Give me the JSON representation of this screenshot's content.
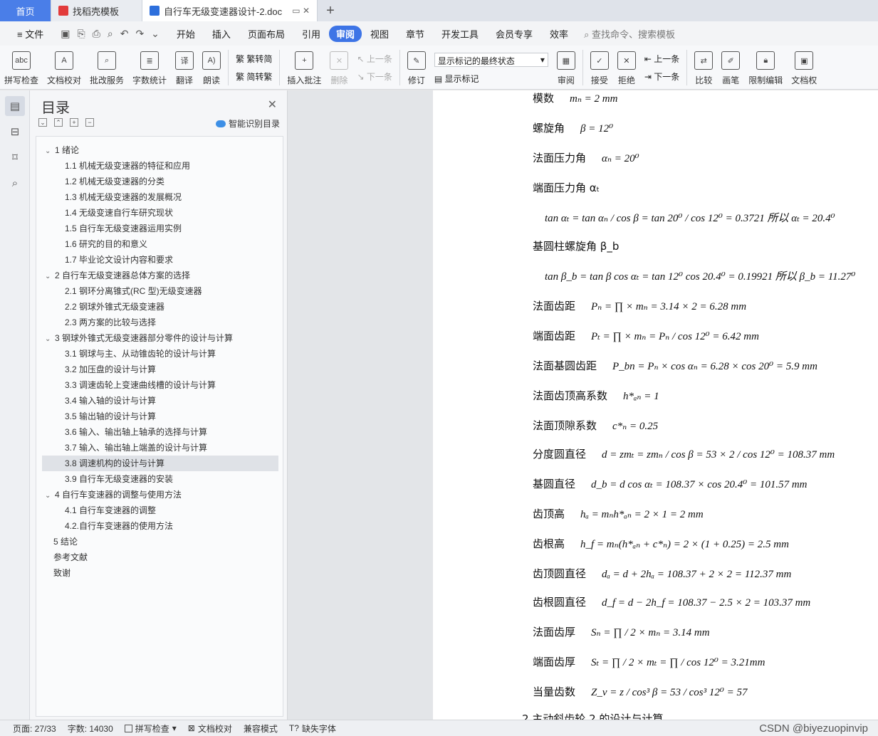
{
  "tabs": [
    {
      "label": "首页"
    },
    {
      "label": "找稻壳模板"
    },
    {
      "label": "自行车无级变速器设计-2.doc"
    }
  ],
  "menu": {
    "file": "文件",
    "items": [
      "开始",
      "插入",
      "页面布局",
      "引用",
      "审阅",
      "视图",
      "章节",
      "开发工具",
      "会员专享",
      "效率"
    ],
    "active": "审阅",
    "search": "查找命令、搜索模板"
  },
  "ribbon": {
    "spell": "拼写检查",
    "doccheck": "文档校对",
    "annotate_service": "批改服务",
    "wordcount": "字数统计",
    "translate": "翻译",
    "read": "朗读",
    "trad": "繁转简",
    "simp": "简转繁",
    "insert_comment": "插入批注",
    "delete": "删除",
    "prev": "上一条",
    "next": "下一条",
    "revise": "修订",
    "show_state": "显示标记的最终状态",
    "show_marks": "显示标记",
    "review": "审阅",
    "accept": "接受",
    "reject": "拒绝",
    "prev2": "上一条",
    "next2": "下一条",
    "compare": "比较",
    "pen": "画笔",
    "restrict": "限制编辑",
    "docpower": "文档权"
  },
  "toc": {
    "title": "目录",
    "smart": "智能识别目录",
    "items": [
      {
        "label": "1 绪论",
        "level": 1
      },
      {
        "label": "1.1    机械无级变速器的特征和应用",
        "level": 2
      },
      {
        "label": "1.2   机械无级变速器的分类",
        "level": 2
      },
      {
        "label": "1.3   机械无级变速器的发展概况",
        "level": 2
      },
      {
        "label": "1.4   无级变速自行车研究现状",
        "level": 2
      },
      {
        "label": "1.5  自行车无级变速器运用实例",
        "level": 2
      },
      {
        "label": "1.6  研究的目的和意义",
        "level": 2
      },
      {
        "label": "1.7  毕业论文设计内容和要求",
        "level": 2
      },
      {
        "label": "2  自行车无级变速器总体方案的选择",
        "level": 1
      },
      {
        "label": "2.1    钢环分离锥式(RC 型)无级变速器",
        "level": 2
      },
      {
        "label": "2.2    钢球外锥式无级变速器",
        "level": 2
      },
      {
        "label": "2.3    两方案的比较与选择",
        "level": 2
      },
      {
        "label": "3  钢球外锥式无级变速器部分零件的设计与计算",
        "level": 1
      },
      {
        "label": "3.1    钢球与主、从动锥齿轮的设计与计算",
        "level": 2
      },
      {
        "label": "3.2    加压盘的设计与计算",
        "level": 2
      },
      {
        "label": "3.3    调速齿轮上变速曲线槽的设计与计算",
        "level": 2
      },
      {
        "label": "3.4    输入轴的设计与计算",
        "level": 2
      },
      {
        "label": "3.5    输出轴的设计与计算",
        "level": 2
      },
      {
        "label": "3.6    输入、输出轴上轴承的选择与计算",
        "level": 2
      },
      {
        "label": "3.7    输入、输出轴上端盖的设计与计算",
        "level": 2
      },
      {
        "label": "3.8    调速机构的设计与计算",
        "level": 2,
        "selected": true
      },
      {
        "label": "3.9    自行车无级变速器的安装",
        "level": 2
      },
      {
        "label": "4  自行车变速器的调整与使用方法",
        "level": 1
      },
      {
        "label": "4.1  自行车变速器的调整",
        "level": 2
      },
      {
        "label": "4.2.自行车变速器的使用方法",
        "level": 2
      },
      {
        "label": "5  结论",
        "level": 0
      },
      {
        "label": "参考文献",
        "level": 0
      },
      {
        "label": "致谢",
        "level": 0
      }
    ]
  },
  "doc": {
    "lines": [
      {
        "label": "模数",
        "formula": "mₙ = 2   mm"
      },
      {
        "label": "螺旋角",
        "formula": "β = 12⁰"
      },
      {
        "label": "法面压力角",
        "formula": "αₙ = 20⁰"
      },
      {
        "label": "端面压力角 αₜ",
        "formula": ""
      },
      {
        "label": "",
        "formula": "tan αₜ = tan αₙ / cos β = tan 20⁰ / cos 12⁰ = 0.3721    所以     αₜ = 20.4⁰"
      },
      {
        "label": "基圆柱螺旋角 β_b",
        "formula": ""
      },
      {
        "label": "",
        "formula": "tan β_b = tan β cos αₜ = tan 12⁰ cos 20.4⁰ = 0.19921   所以    β_b = 11.27⁰"
      },
      {
        "label": "法面齿距",
        "formula": "Pₙ = ∏ × mₙ = 3.14 × 2 = 6.28   mm"
      },
      {
        "label": "端面齿距",
        "formula": "Pₜ = ∏ × mₙ = Pₙ / cos 12⁰ = 6.42   mm"
      },
      {
        "label": "法面基圆齿距",
        "formula": "P_bn = Pₙ × cos αₙ = 6.28 × cos 20⁰ = 5.9   mm"
      },
      {
        "label": "法面齿顶高系数",
        "formula": "h*ₐₙ = 1"
      },
      {
        "label": "法面顶隙系数",
        "formula": "c*ₙ = 0.25"
      },
      {
        "label": "分度圆直径",
        "formula": "d = zmₜ = zmₙ / cos β = 53 × 2 / cos 12⁰ = 108.37   mm"
      },
      {
        "label": "基圆直径",
        "formula": "d_b = d cos αₜ = 108.37 × cos 20.4⁰ = 101.57 mm"
      },
      {
        "label": "齿顶高",
        "formula": "hₐ = mₙh*ₐₙ = 2 × 1 = 2   mm"
      },
      {
        "label": "齿根高",
        "formula": "h_f = mₙ(h*ₐₙ + c*ₙ) = 2 × (1 + 0.25) = 2.5 mm"
      },
      {
        "label": "齿顶圆直径",
        "formula": "dₐ = d + 2hₐ = 108.37 + 2 × 2 = 112.37   mm"
      },
      {
        "label": "齿根圆直径",
        "formula": "d_f = d − 2h_f = 108.37 − 2.5 × 2 = 103.37 mm"
      },
      {
        "label": "法面齿厚",
        "formula": "Sₙ = ∏ / 2 × mₙ = 3.14   mm"
      },
      {
        "label": "端面齿厚",
        "formula": "Sₜ = ∏ / 2 × mₜ = ∏ / cos 12⁰ = 3.21mm"
      },
      {
        "label": "当量齿数",
        "formula": "Z_v = z / cos³ β = 53 / cos³ 12⁰ = 57"
      },
      {
        "label": "2  主动斜齿轮 2 的设计与计算",
        "formula": ""
      }
    ]
  },
  "status": {
    "page": "页面: 27/33",
    "words": "字数: 14030",
    "spell": "拼写检查",
    "doccheck": "文档校对",
    "compat": "兼容模式",
    "missingfont": "缺失字体",
    "watermark": "CSDN @biyezuopinvip"
  }
}
